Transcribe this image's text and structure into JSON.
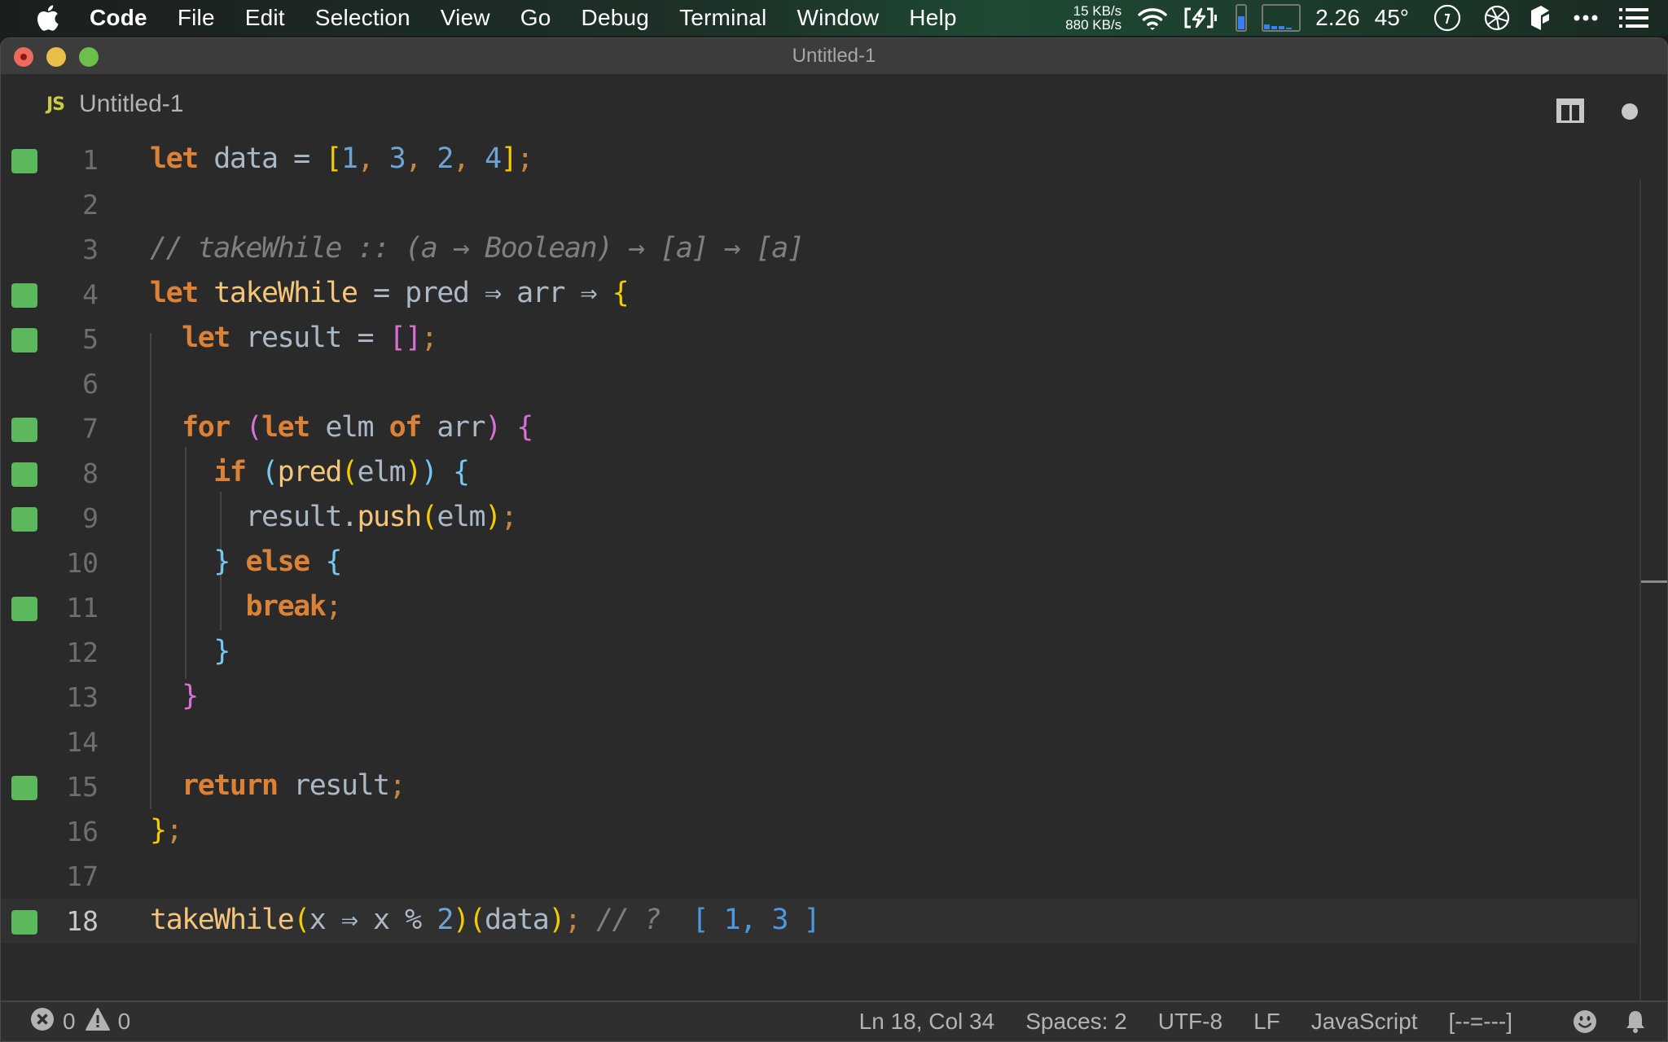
{
  "menubar": {
    "app_name": "Code",
    "items": [
      "File",
      "Edit",
      "Selection",
      "View",
      "Go",
      "Debug",
      "Terminal",
      "Window",
      "Help"
    ],
    "net_up": "15 KB/s",
    "net_down": "880 KB/s",
    "load_avg": "2.26",
    "temperature": "45°",
    "battery_level_percent": 60,
    "icons": [
      "apple-icon",
      "wifi-icon",
      "battery-charging-icon",
      "memory-meter-icon",
      "cpu-graph-icon",
      "clock-icon",
      "aperture-icon",
      "box-icon",
      "more-icon",
      "list-icon"
    ]
  },
  "window": {
    "title": "Untitled-1"
  },
  "tab": {
    "icon_label": "JS",
    "label": "Untitled-1",
    "dirty": true
  },
  "editor": {
    "lines": [
      {
        "n": "1",
        "mark": true
      },
      {
        "n": "2",
        "mark": false
      },
      {
        "n": "3",
        "mark": false
      },
      {
        "n": "4",
        "mark": true
      },
      {
        "n": "5",
        "mark": true
      },
      {
        "n": "6",
        "mark": false
      },
      {
        "n": "7",
        "mark": true
      },
      {
        "n": "8",
        "mark": true
      },
      {
        "n": "9",
        "mark": true
      },
      {
        "n": "10",
        "mark": false
      },
      {
        "n": "11",
        "mark": true
      },
      {
        "n": "12",
        "mark": false
      },
      {
        "n": "13",
        "mark": false
      },
      {
        "n": "14",
        "mark": false
      },
      {
        "n": "15",
        "mark": true
      },
      {
        "n": "16",
        "mark": false
      },
      {
        "n": "17",
        "mark": false
      },
      {
        "n": "18",
        "mark": true
      }
    ],
    "tokens": {
      "l1": [
        "let",
        " data = ",
        "[",
        "1",
        ", ",
        "3",
        ", ",
        "2",
        ", ",
        "4",
        "]",
        ";"
      ],
      "l3": [
        "// takeWhile :: (a → Boolean) → [a] → [a]"
      ],
      "l4": [
        "let",
        " ",
        "takeWhile",
        " = pred ⇒ arr ⇒ ",
        "{"
      ],
      "l5": [
        "  ",
        "let",
        " result = ",
        "[]",
        ";"
      ],
      "l7": [
        "  ",
        "for",
        " ",
        "(",
        "let",
        " elm ",
        "of",
        " arr",
        ")",
        " ",
        "{"
      ],
      "l8": [
        "    ",
        "if",
        " ",
        "(",
        "pred",
        "(",
        "elm",
        ")",
        ")",
        " ",
        "{"
      ],
      "l9": [
        "      result.",
        "push",
        "(",
        "elm",
        ")",
        ";"
      ],
      "l10": [
        "    ",
        "}",
        " ",
        "else",
        " ",
        "{"
      ],
      "l11": [
        "      ",
        "break",
        ";"
      ],
      "l12": [
        "    ",
        "}"
      ],
      "l13": [
        "  ",
        "}"
      ],
      "l15": [
        "  ",
        "return",
        " result",
        ";"
      ],
      "l16": [
        "}",
        ";"
      ],
      "l18": [
        "takeWhile",
        "(",
        "x ⇒ x % ",
        "2",
        ")",
        "(",
        "data",
        ")",
        ";",
        " // ? ",
        " [ 1, 3 ]"
      ]
    },
    "current_line": "18"
  },
  "statusbar": {
    "errors": "0",
    "warnings": "0",
    "cursor": "Ln 18, Col 34",
    "indent": "Spaces: 2",
    "encoding": "UTF-8",
    "eol": "LF",
    "language": "JavaScript",
    "extra": "[--=---]"
  },
  "colors": {
    "gutter_added": "#5cb85c",
    "keyword": "#db8237",
    "function": "#f5c57a",
    "number": "#6ea4d4",
    "comment": "#7f7f7f"
  }
}
